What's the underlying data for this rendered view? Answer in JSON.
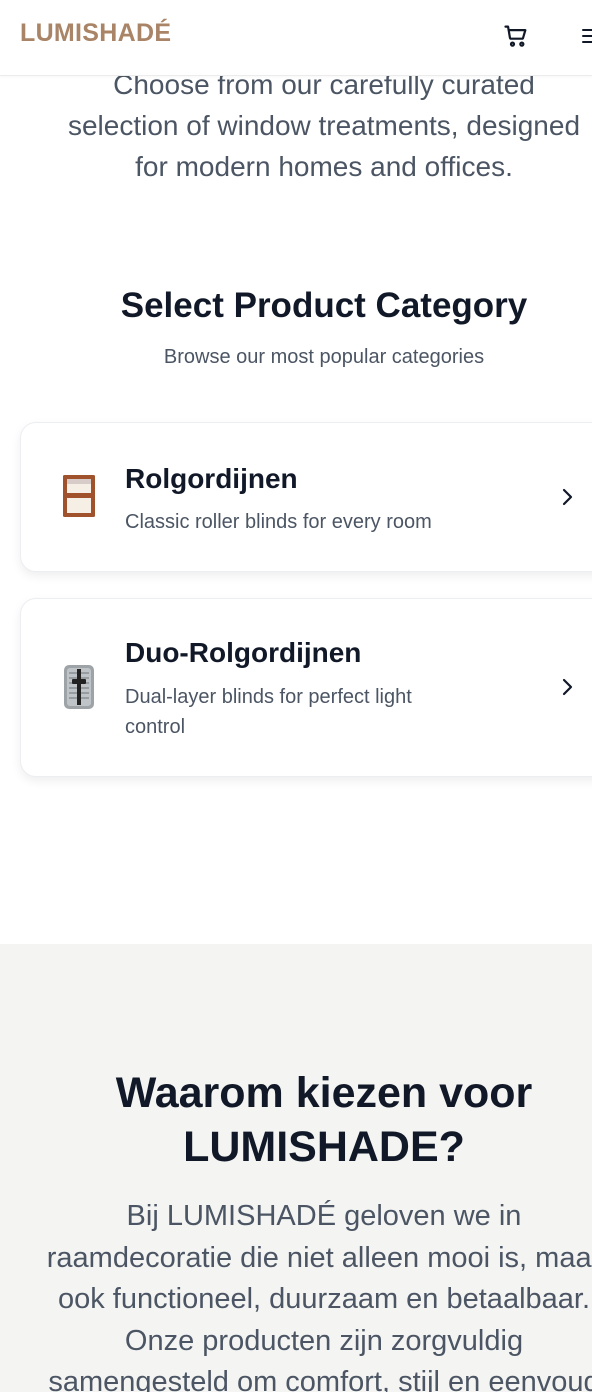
{
  "header": {
    "logo": "LUMISHADÉ",
    "cart_icon": "cart-icon",
    "menu_icon": "menu-icon"
  },
  "intro": {
    "lines": [
      "Choose from our carefully curated",
      "selection of window treatments, designed",
      "for modern homes and offices."
    ]
  },
  "categories": {
    "title": "Select Product Category",
    "subtitle": "Browse our most popular categories",
    "items": [
      {
        "icon": "window-icon",
        "title": "Rolgordijnen",
        "description": "Classic roller blinds for every room"
      },
      {
        "icon": "duo-blind-icon",
        "title": "Duo-Rolgordijnen",
        "description": "Dual-layer blinds for perfect light control"
      }
    ]
  },
  "why": {
    "title_lines": [
      "Waarom kiezen voor",
      "LUMISHADE?"
    ],
    "text_lines": [
      "Bij LUMISHADÉ geloven we in",
      "raamdecoratie die niet alleen mooi is, maar",
      "ook functioneel, duurzaam en betaalbaar.",
      "Onze producten zijn zorgvuldig",
      "samengesteld om comfort, stijl en eenvoud"
    ]
  },
  "colors": {
    "brand": "#a98467",
    "heading": "#111827",
    "body_text": "#4b5563",
    "section_bg": "#f4f4f3"
  }
}
